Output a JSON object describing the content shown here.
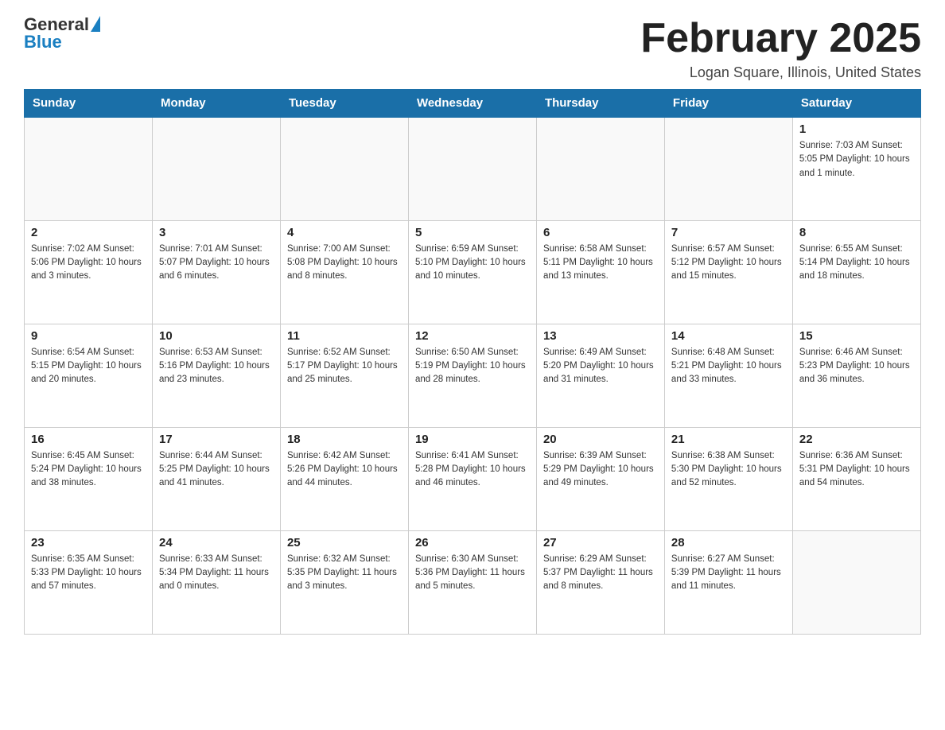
{
  "header": {
    "logo_general": "General",
    "logo_blue": "Blue",
    "title": "February 2025",
    "subtitle": "Logan Square, Illinois, United States"
  },
  "calendar": {
    "days_of_week": [
      "Sunday",
      "Monday",
      "Tuesday",
      "Wednesday",
      "Thursday",
      "Friday",
      "Saturday"
    ],
    "weeks": [
      [
        {
          "day": "",
          "info": ""
        },
        {
          "day": "",
          "info": ""
        },
        {
          "day": "",
          "info": ""
        },
        {
          "day": "",
          "info": ""
        },
        {
          "day": "",
          "info": ""
        },
        {
          "day": "",
          "info": ""
        },
        {
          "day": "1",
          "info": "Sunrise: 7:03 AM\nSunset: 5:05 PM\nDaylight: 10 hours and 1 minute."
        }
      ],
      [
        {
          "day": "2",
          "info": "Sunrise: 7:02 AM\nSunset: 5:06 PM\nDaylight: 10 hours and 3 minutes."
        },
        {
          "day": "3",
          "info": "Sunrise: 7:01 AM\nSunset: 5:07 PM\nDaylight: 10 hours and 6 minutes."
        },
        {
          "day": "4",
          "info": "Sunrise: 7:00 AM\nSunset: 5:08 PM\nDaylight: 10 hours and 8 minutes."
        },
        {
          "day": "5",
          "info": "Sunrise: 6:59 AM\nSunset: 5:10 PM\nDaylight: 10 hours and 10 minutes."
        },
        {
          "day": "6",
          "info": "Sunrise: 6:58 AM\nSunset: 5:11 PM\nDaylight: 10 hours and 13 minutes."
        },
        {
          "day": "7",
          "info": "Sunrise: 6:57 AM\nSunset: 5:12 PM\nDaylight: 10 hours and 15 minutes."
        },
        {
          "day": "8",
          "info": "Sunrise: 6:55 AM\nSunset: 5:14 PM\nDaylight: 10 hours and 18 minutes."
        }
      ],
      [
        {
          "day": "9",
          "info": "Sunrise: 6:54 AM\nSunset: 5:15 PM\nDaylight: 10 hours and 20 minutes."
        },
        {
          "day": "10",
          "info": "Sunrise: 6:53 AM\nSunset: 5:16 PM\nDaylight: 10 hours and 23 minutes."
        },
        {
          "day": "11",
          "info": "Sunrise: 6:52 AM\nSunset: 5:17 PM\nDaylight: 10 hours and 25 minutes."
        },
        {
          "day": "12",
          "info": "Sunrise: 6:50 AM\nSunset: 5:19 PM\nDaylight: 10 hours and 28 minutes."
        },
        {
          "day": "13",
          "info": "Sunrise: 6:49 AM\nSunset: 5:20 PM\nDaylight: 10 hours and 31 minutes."
        },
        {
          "day": "14",
          "info": "Sunrise: 6:48 AM\nSunset: 5:21 PM\nDaylight: 10 hours and 33 minutes."
        },
        {
          "day": "15",
          "info": "Sunrise: 6:46 AM\nSunset: 5:23 PM\nDaylight: 10 hours and 36 minutes."
        }
      ],
      [
        {
          "day": "16",
          "info": "Sunrise: 6:45 AM\nSunset: 5:24 PM\nDaylight: 10 hours and 38 minutes."
        },
        {
          "day": "17",
          "info": "Sunrise: 6:44 AM\nSunset: 5:25 PM\nDaylight: 10 hours and 41 minutes."
        },
        {
          "day": "18",
          "info": "Sunrise: 6:42 AM\nSunset: 5:26 PM\nDaylight: 10 hours and 44 minutes."
        },
        {
          "day": "19",
          "info": "Sunrise: 6:41 AM\nSunset: 5:28 PM\nDaylight: 10 hours and 46 minutes."
        },
        {
          "day": "20",
          "info": "Sunrise: 6:39 AM\nSunset: 5:29 PM\nDaylight: 10 hours and 49 minutes."
        },
        {
          "day": "21",
          "info": "Sunrise: 6:38 AM\nSunset: 5:30 PM\nDaylight: 10 hours and 52 minutes."
        },
        {
          "day": "22",
          "info": "Sunrise: 6:36 AM\nSunset: 5:31 PM\nDaylight: 10 hours and 54 minutes."
        }
      ],
      [
        {
          "day": "23",
          "info": "Sunrise: 6:35 AM\nSunset: 5:33 PM\nDaylight: 10 hours and 57 minutes."
        },
        {
          "day": "24",
          "info": "Sunrise: 6:33 AM\nSunset: 5:34 PM\nDaylight: 11 hours and 0 minutes."
        },
        {
          "day": "25",
          "info": "Sunrise: 6:32 AM\nSunset: 5:35 PM\nDaylight: 11 hours and 3 minutes."
        },
        {
          "day": "26",
          "info": "Sunrise: 6:30 AM\nSunset: 5:36 PM\nDaylight: 11 hours and 5 minutes."
        },
        {
          "day": "27",
          "info": "Sunrise: 6:29 AM\nSunset: 5:37 PM\nDaylight: 11 hours and 8 minutes."
        },
        {
          "day": "28",
          "info": "Sunrise: 6:27 AM\nSunset: 5:39 PM\nDaylight: 11 hours and 11 minutes."
        },
        {
          "day": "",
          "info": ""
        }
      ]
    ]
  }
}
